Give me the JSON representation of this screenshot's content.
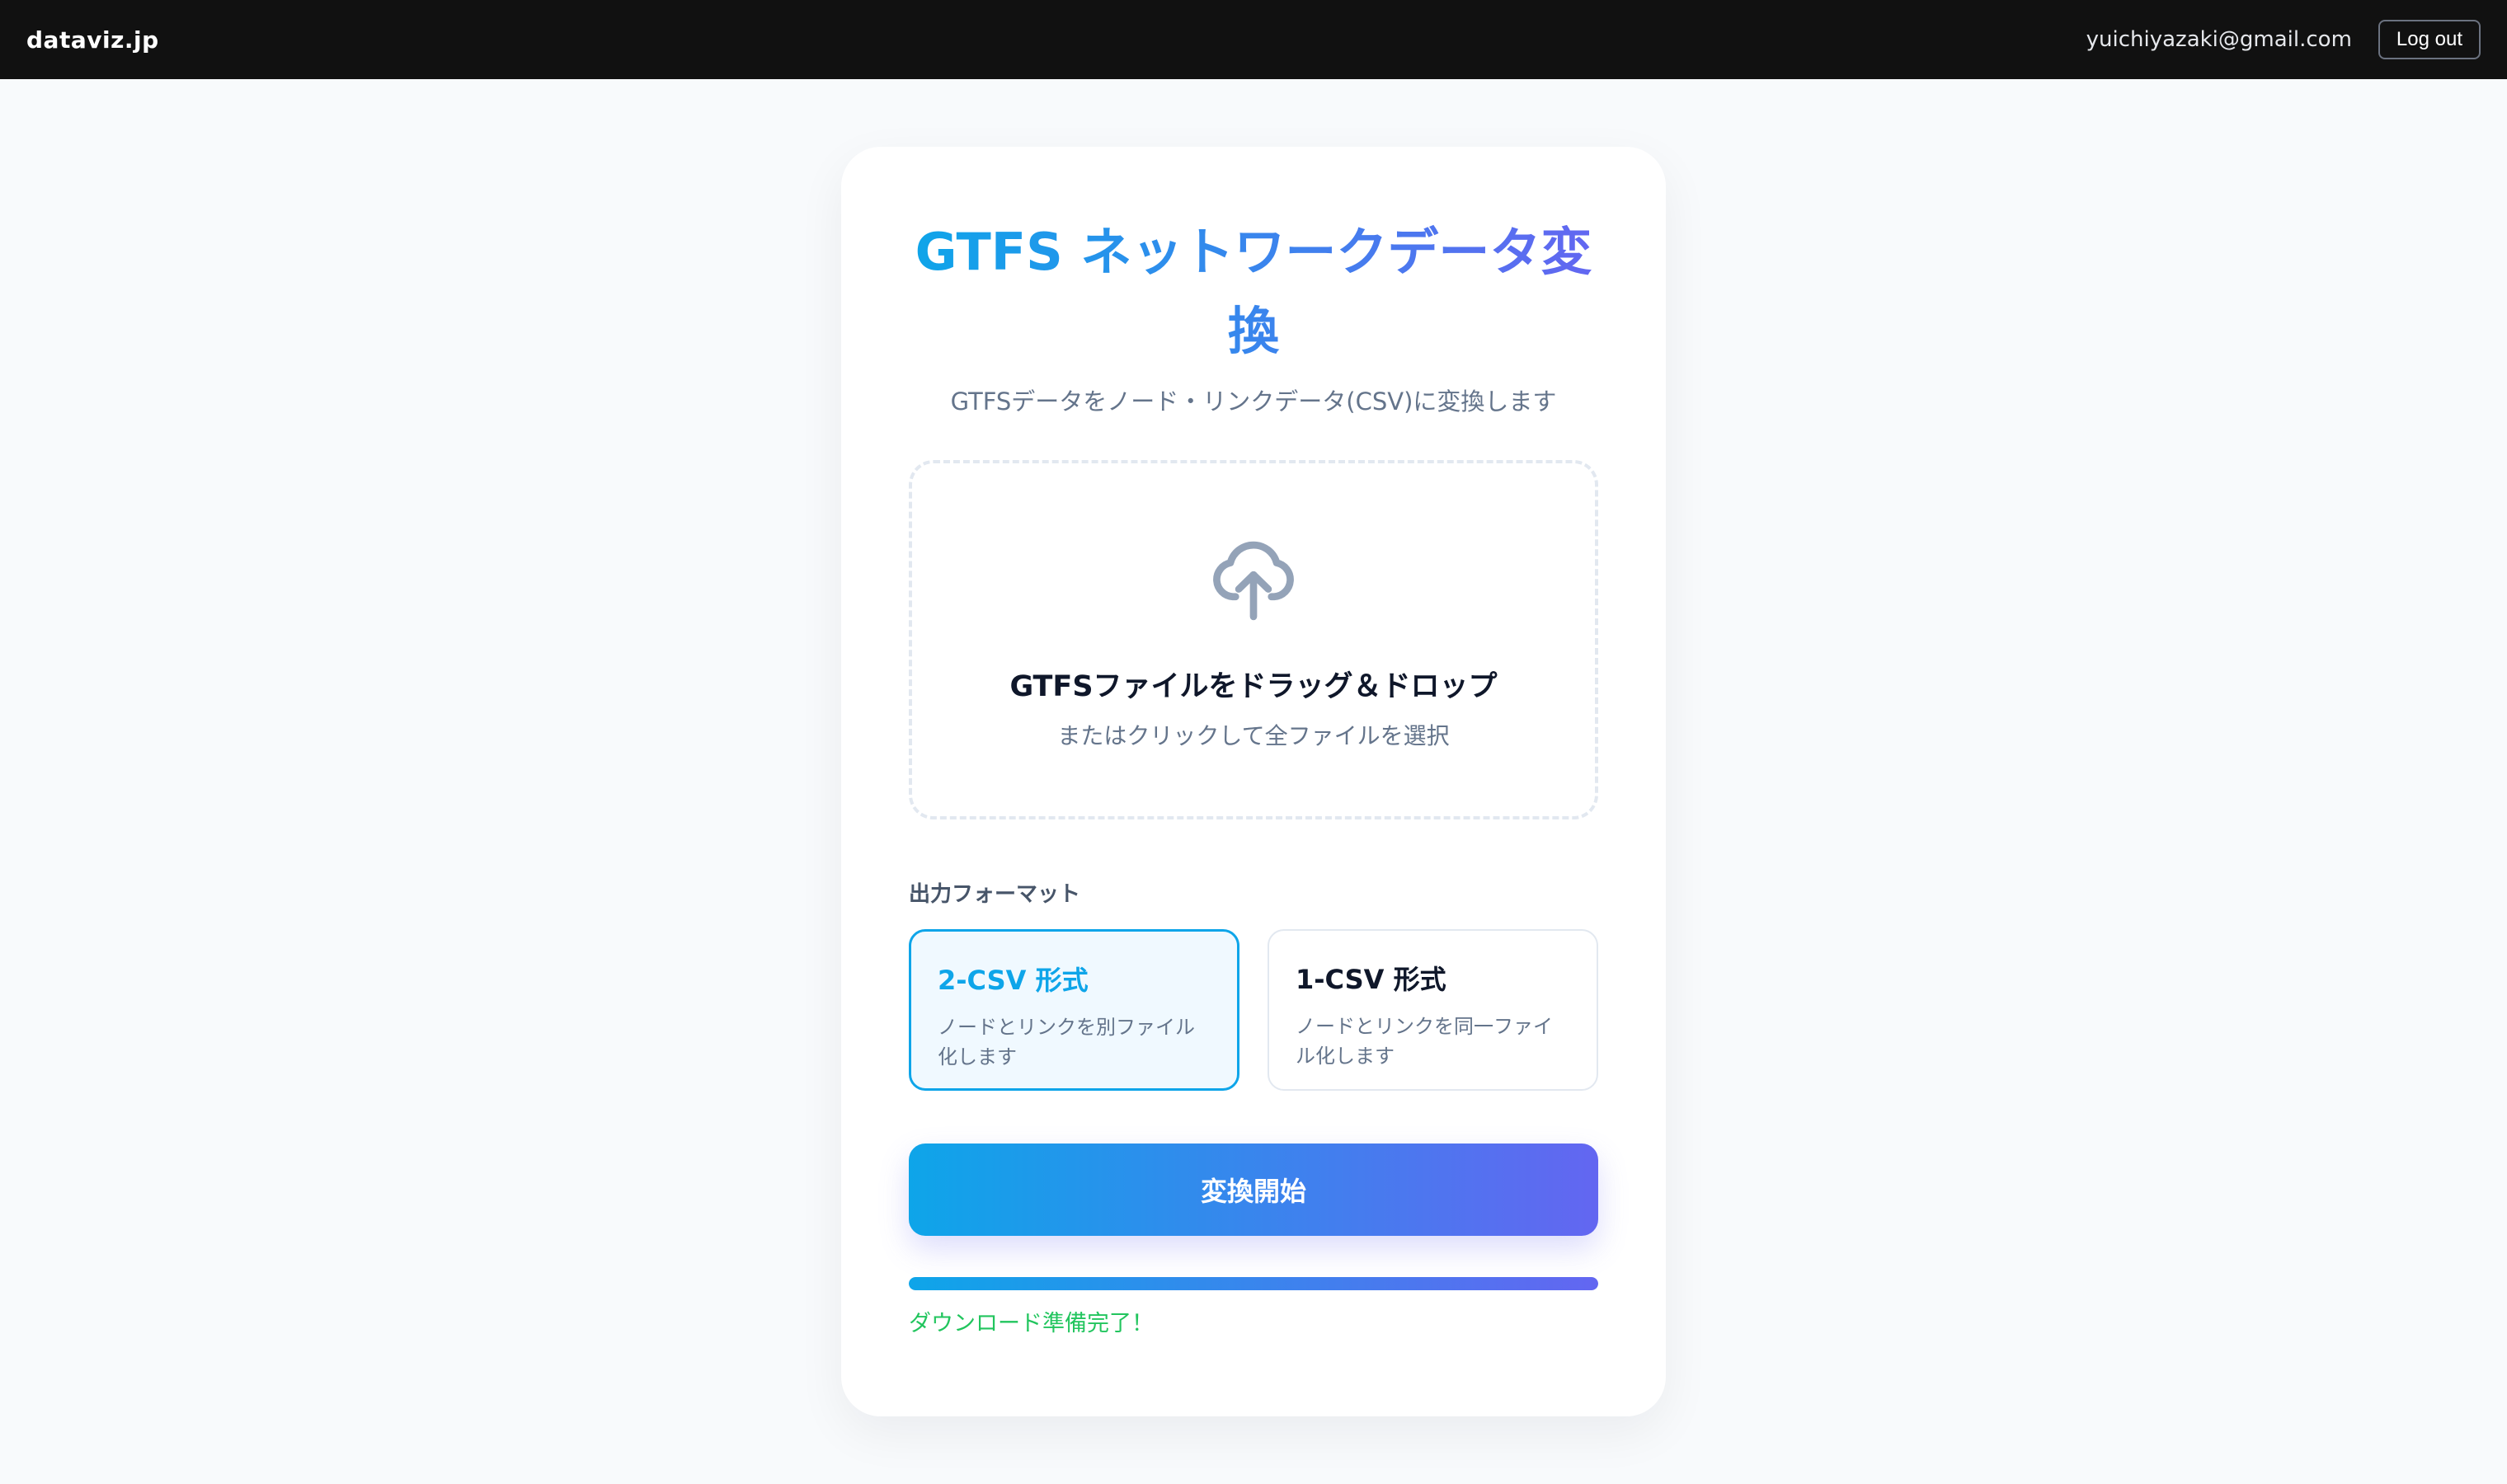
{
  "header": {
    "brand": "dataviz.jp",
    "user_email": "yuichiyazaki@gmail.com",
    "logout_label": "Log out"
  },
  "converter": {
    "title": "GTFS ネットワークデータ変換",
    "subtitle": "GTFSデータをノード・リンクデータ(CSV)に変換します",
    "dropzone": {
      "icon": "cloud-upload-icon",
      "title": "GTFSファイルをドラッグ＆ドロップ",
      "subtitle": "またはクリックして全ファイルを選択"
    },
    "format": {
      "label": "出力フォーマット",
      "options": [
        {
          "title": "2-CSV 形式",
          "description": "ノードとリンクを別ファイル化します",
          "selected": true
        },
        {
          "title": "1-CSV 形式",
          "description": "ノードとリンクを同一ファイル化します",
          "selected": false
        }
      ]
    },
    "convert_label": "変換開始",
    "progress": 1.0,
    "status_text": "ダウンロード準備完了！"
  },
  "colors": {
    "accent_start": "#0ea5e9",
    "accent_end": "#6366f1",
    "success": "#22c55e",
    "topbar": "#111111"
  }
}
